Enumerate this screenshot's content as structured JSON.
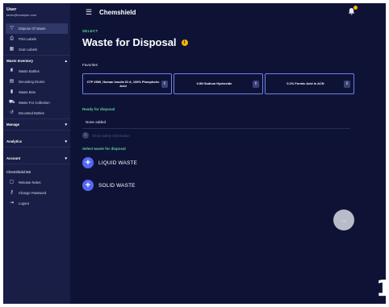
{
  "user": {
    "name": "User",
    "email": "kevin@example.com"
  },
  "sidebar": {
    "top_items": [
      {
        "label": "Dispose Of Waste",
        "icon": "filter-icon",
        "glyph": "▽",
        "active": true
      },
      {
        "label": "Print Labels",
        "icon": "printer-icon",
        "glyph": "⎙",
        "active": false
      },
      {
        "label": "Scan Labels",
        "icon": "barcode-icon",
        "glyph": "▦",
        "active": false
      }
    ],
    "waste_inventory": {
      "label": "Waste Inventory",
      "items": [
        {
          "label": "Waste Bottles",
          "icon": "bottle-icon",
          "glyph": "♜"
        },
        {
          "label": "Decanting Drums",
          "icon": "drum-icon",
          "glyph": "▤"
        },
        {
          "label": "Waste Bins",
          "icon": "bin-icon",
          "glyph": "▮"
        },
        {
          "label": "Waste For Collection",
          "icon": "truck-icon",
          "glyph": "⛟"
        },
        {
          "label": "Decanted Bottles",
          "icon": "undo-icon",
          "glyph": "↺"
        }
      ]
    },
    "manage_label": "Manage",
    "analytics_label": "Analytics",
    "account_label": "Account",
    "footer": {
      "version": "ChemShield MS",
      "items": [
        {
          "label": "Release Notes",
          "icon": "notes-icon",
          "glyph": "▢"
        },
        {
          "label": "Change Password",
          "icon": "key-icon",
          "glyph": "⚷"
        },
        {
          "label": "Logout",
          "icon": "logout-icon",
          "glyph": "⇥"
        }
      ]
    }
  },
  "header": {
    "app_title": "Chemshield",
    "menu_glyph": "☰",
    "bell_glyph": "🔔"
  },
  "main": {
    "overline": "SELECT",
    "title": "Waste for Disposal",
    "info_glyph": "i",
    "favorites_label": "Favorites",
    "favorites": [
      {
        "label": "CTP 2593_Human Insulin ID A_100% Phosphoric Acid"
      },
      {
        "label": "0.5N Sodium Hydroxide"
      },
      {
        "label": "0.1% Formic Acid in ACN"
      }
    ],
    "ready_label": "Ready for disposal",
    "none_added": "None added",
    "safety_label": "Show Safety Information",
    "select_label": "Select waste for disposal",
    "options": [
      {
        "label": "LIQUID WASTE"
      },
      {
        "label": "SOLID WASTE"
      }
    ],
    "fab_glyph": "→"
  },
  "colors": {
    "background": "#0e1336",
    "sidebar": "#181e45",
    "accent": "#5468f0",
    "green": "#5ed39a",
    "yellow": "#f4b400"
  },
  "step_number": "1"
}
